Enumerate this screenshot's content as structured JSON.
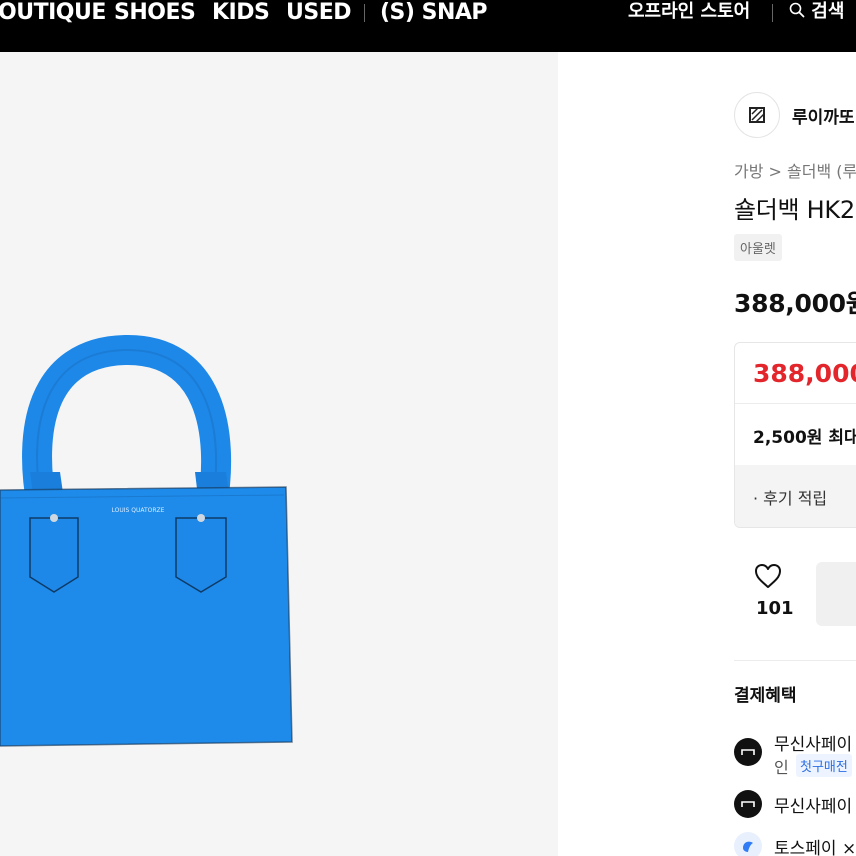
{
  "nav": {
    "items": [
      "OUTIQUE",
      "SHOES",
      "KIDS",
      "USED",
      "(S) SNAP"
    ],
    "offline_store": "오프라인 스토어",
    "search": "검색"
  },
  "brand": {
    "name": "루이까또"
  },
  "breadcrumb": "가방 > 숄더백 (루",
  "product": {
    "title": "숄더백 HK2",
    "tag": "아울렛",
    "price": "388,000원"
  },
  "price_box": {
    "sale_price": "388,000",
    "point": "2,500원 최대",
    "review_reward": "· 후기 적립"
  },
  "like": {
    "count": "101"
  },
  "benefits": {
    "title": "결제혜택",
    "items": [
      {
        "label": "무신사페이",
        "sub": "인",
        "chip": "첫구매전"
      },
      {
        "label": "무신사페이"
      },
      {
        "label": "토스페이 ×"
      }
    ]
  },
  "colors": {
    "bag_blue": "#1e88e8",
    "sale_red": "#e3262b"
  },
  "icons": {
    "search": "search-icon",
    "heart": "heart-icon",
    "brand_logo": "brand-logo-icon"
  }
}
